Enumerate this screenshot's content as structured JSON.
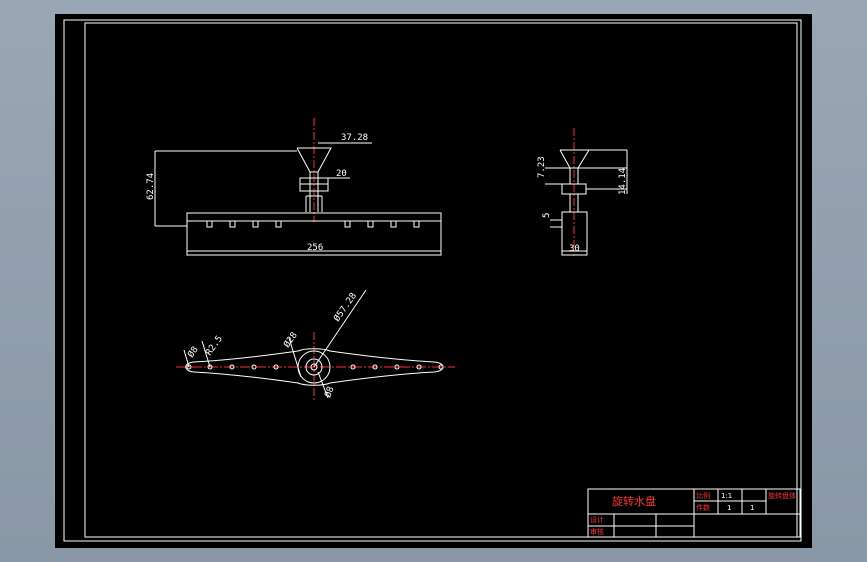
{
  "drawing": {
    "colors": {
      "background": "#000000",
      "frame": "#ffffff",
      "geometry": "#ffffff",
      "centerline": "#ff2a2a",
      "title_text": "#ff3333",
      "workspace_bg": "#8f9cab"
    },
    "front_view": {
      "dim_top": "37.28",
      "dim_hub": "20",
      "dim_height": "62.74",
      "dim_length": "256"
    },
    "side_view": {
      "dim_a": "7.23",
      "dim_b": "14.14",
      "dim_c": "5",
      "dim_width": "30"
    },
    "top_view": {
      "dim_hole": "R2.5",
      "dim_tip": "Ø8",
      "dim_inner": "Ø28",
      "dim_outer": "Ø57.28",
      "dim_center": "Ø8"
    }
  },
  "title_block": {
    "title": "旋转水盘",
    "ratio_label": "比例",
    "ratio_value": "1:1",
    "count_label": "件数",
    "count_value": "1",
    "sheet_value": "1",
    "drawing_no": "旋转盘体",
    "design_label": "设计",
    "check_label": "审核"
  }
}
